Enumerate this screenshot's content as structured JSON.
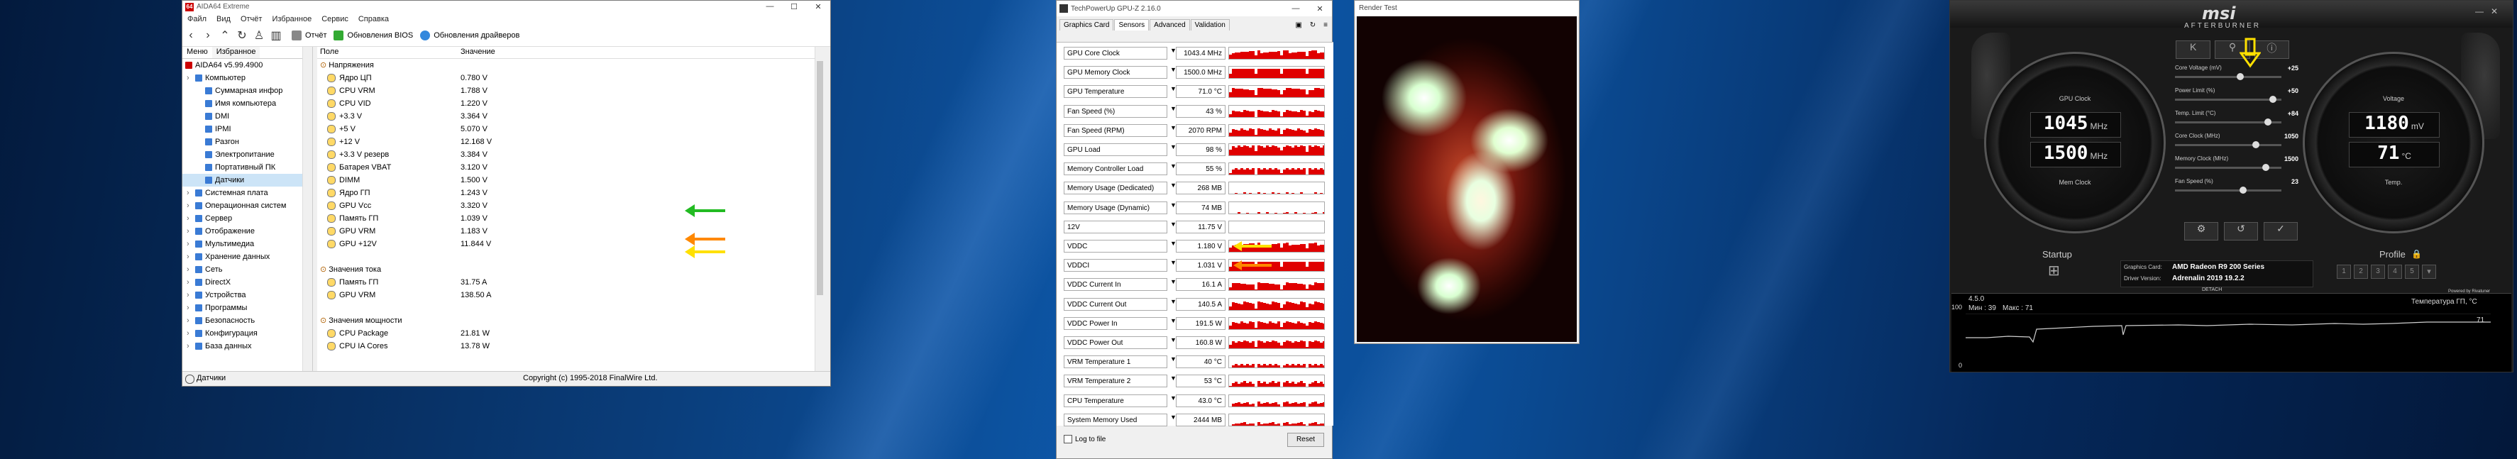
{
  "aida": {
    "title": "AIDA64 Extreme",
    "menu": [
      "Файл",
      "Вид",
      "Отчёт",
      "Избранное",
      "Сервис",
      "Справка"
    ],
    "toolbar": {
      "report": "Отчёт",
      "bios": "Обновления BIOS",
      "drivers": "Обновления драйверов"
    },
    "tabs": [
      "Меню",
      "Избранное"
    ],
    "tree": [
      {
        "label": "AIDA64 v5.99.4900",
        "level": 0
      },
      {
        "label": "Компьютер",
        "level": 1
      },
      {
        "label": "Суммарная инфор",
        "level": 2
      },
      {
        "label": "Имя компьютера",
        "level": 2
      },
      {
        "label": "DMI",
        "level": 2
      },
      {
        "label": "IPMI",
        "level": 2
      },
      {
        "label": "Разгон",
        "level": 2
      },
      {
        "label": "Электропитание",
        "level": 2
      },
      {
        "label": "Портативный ПК",
        "level": 2
      },
      {
        "label": "Датчики",
        "level": 2
      },
      {
        "label": "Системная плата",
        "level": 1
      },
      {
        "label": "Операционная систем",
        "level": 1
      },
      {
        "label": "Сервер",
        "level": 1
      },
      {
        "label": "Отображение",
        "level": 1
      },
      {
        "label": "Мультимедиа",
        "level": 1
      },
      {
        "label": "Хранение данных",
        "level": 1
      },
      {
        "label": "Сеть",
        "level": 1
      },
      {
        "label": "DirectX",
        "level": 1
      },
      {
        "label": "Устройства",
        "level": 1
      },
      {
        "label": "Программы",
        "level": 1
      },
      {
        "label": "Безопасность",
        "level": 1
      },
      {
        "label": "Конфигурация",
        "level": 1
      },
      {
        "label": "База данных",
        "level": 1
      }
    ],
    "columns": {
      "field": "Поле",
      "value": "Значение"
    },
    "rows": [
      {
        "type": "section",
        "label": "Напряжения"
      },
      {
        "label": "Ядро ЦП",
        "value": "0.780 V"
      },
      {
        "label": "CPU VRM",
        "value": "1.788 V"
      },
      {
        "label": "CPU VID",
        "value": "1.220 V"
      },
      {
        "label": "+3.3 V",
        "value": "3.364 V"
      },
      {
        "label": "+5 V",
        "value": "5.070 V"
      },
      {
        "label": "+12 V",
        "value": "12.168 V"
      },
      {
        "label": "+3.3 V резерв",
        "value": "3.384 V"
      },
      {
        "label": "Батарея VBAT",
        "value": "3.120 V"
      },
      {
        "label": "DIMM",
        "value": "1.500 V"
      },
      {
        "label": "Ядро ГП",
        "value": "1.243 V"
      },
      {
        "label": "GPU Vcc",
        "value": "3.320 V"
      },
      {
        "label": "Память ГП",
        "value": "1.039 V"
      },
      {
        "label": "GPU VRM",
        "value": "1.183 V"
      },
      {
        "label": "GPU +12V",
        "value": "11.844 V"
      },
      {
        "type": "blank"
      },
      {
        "type": "section",
        "label": "Значения тока"
      },
      {
        "label": "Память ГП",
        "value": "31.75 A"
      },
      {
        "label": "GPU VRM",
        "value": "138.50 A"
      },
      {
        "type": "blank"
      },
      {
        "type": "section",
        "label": "Значения мощности"
      },
      {
        "label": "CPU Package",
        "value": "21.81 W"
      },
      {
        "label": "CPU IA Cores",
        "value": "13.78 W"
      }
    ],
    "status_left": "Датчики",
    "status_right": "Copyright (c) 1995-2018 FinalWire Ltd."
  },
  "gpuz": {
    "title": "TechPowerUp GPU-Z 2.16.0",
    "tabs": [
      "Graphics Card",
      "Sensors",
      "Advanced",
      "Validation"
    ],
    "sensors": [
      {
        "name": "GPU Core Clock",
        "value": "1043.4 MHz",
        "fill": 0.75
      },
      {
        "name": "GPU Memory Clock",
        "value": "1500.0 MHz",
        "fill": 0.8
      },
      {
        "name": "GPU Temperature",
        "value": "71.0 °C",
        "fill": 0.85
      },
      {
        "name": "Fan Speed (%)",
        "value": "43 %",
        "fill": 0.6
      },
      {
        "name": "Fan Speed (RPM)",
        "value": "2070 RPM",
        "fill": 0.7
      },
      {
        "name": "GPU Load",
        "value": "98 %",
        "fill": 0.9
      },
      {
        "name": "Memory Controller Load",
        "value": "55 %",
        "fill": 0.55
      },
      {
        "name": "Memory Usage (Dedicated)",
        "value": "268 MB",
        "fill": 0.15
      },
      {
        "name": "Memory Usage (Dynamic)",
        "value": "74 MB",
        "fill": 0.1
      },
      {
        "name": "12V",
        "value": "11.75 V",
        "fill": 0.0
      },
      {
        "name": "VDDC",
        "value": "1.180 V",
        "fill": 0.8
      },
      {
        "name": "VDDCI",
        "value": "1.031 V",
        "fill": 0.8
      },
      {
        "name": "VDDC Current In",
        "value": "16.1 A",
        "fill": 0.7
      },
      {
        "name": "VDDC Current Out",
        "value": "140.5 A",
        "fill": 0.7
      },
      {
        "name": "VDDC Power In",
        "value": "191.5 W",
        "fill": 0.7
      },
      {
        "name": "VDDC Power Out",
        "value": "160.8 W",
        "fill": 0.7
      },
      {
        "name": "VRM Temperature 1",
        "value": "40 °C",
        "fill": 0.35
      },
      {
        "name": "VRM Temperature 2",
        "value": "53 °C",
        "fill": 0.5
      },
      {
        "name": "CPU Temperature",
        "value": "43.0 °C",
        "fill": 0.4
      },
      {
        "name": "System Memory Used",
        "value": "2444 MB",
        "fill": 0.3
      }
    ],
    "log_to_file": "Log to file",
    "reset": "Reset"
  },
  "render": {
    "title": "Render Test"
  },
  "msi": {
    "brand": "msi",
    "title": "AFTERBURNER",
    "sliders": [
      {
        "label": "Core Voltage (mV)",
        "value": "+25",
        "fill": 0.62
      },
      {
        "label": "Power Limit (%)",
        "value": "+50",
        "fill": 0.95
      },
      {
        "label": "Temp. Limit (°C)",
        "value": "+84",
        "fill": 0.9
      },
      {
        "label": "Core Clock (MHz)",
        "value": "1050",
        "fill": 0.78
      },
      {
        "label": "Memory Clock (MHz)",
        "value": "1500",
        "fill": 0.88
      },
      {
        "label": "Fan Speed (%)",
        "value": "23",
        "fill": 0.65
      }
    ],
    "left_dial": {
      "top_label": "GPU Clock",
      "core_value": "1045",
      "core_unit": "MHz",
      "mem_value": "1500",
      "mem_unit": "MHz",
      "bottom_label": "Mem Clock"
    },
    "right_dial": {
      "top_label": "Voltage",
      "volt_value": "1180",
      "volt_unit": "mV",
      "temp_value": "71",
      "temp_unit": "°C",
      "bottom_label": "Temp."
    },
    "startup": "Startup",
    "profile": "Profile",
    "graphics_card_label": "Graphics Card:",
    "graphics_card": "AMD Radeon R9 200 Series",
    "driver_label": "Driver Version:",
    "driver": "Adrenalin 2019 19.2.2",
    "detach": "DETACH",
    "version": "4.5.0",
    "min_label": "Мин : 39",
    "max_label": "Макс : 71",
    "graph_title": "Температура ГП, °C",
    "graph_top": "100",
    "graph_val": "71",
    "graph_zero": "0",
    "powered": "Powered by Rivatuner"
  },
  "colors": {
    "gpuz_bar": "#e00000",
    "arrow_green": "#22bb22",
    "arrow_orange": "#ff8800",
    "arrow_yellow": "#ffe000"
  }
}
